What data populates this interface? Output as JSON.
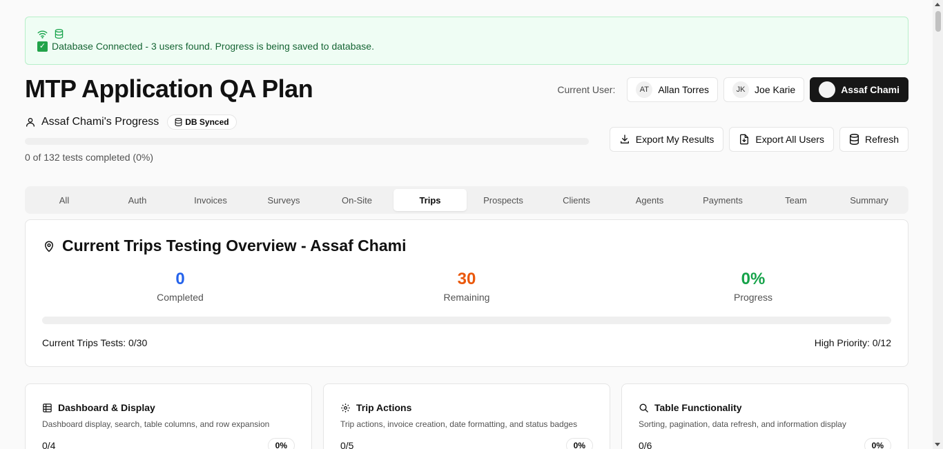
{
  "banner": {
    "message": "Database Connected - 3 users found. Progress is being saved to database.",
    "icons": [
      "wifi-icon",
      "database-icon",
      "check-icon"
    ]
  },
  "header": {
    "title": "MTP Application QA Plan",
    "current_user_label": "Current User:",
    "users": [
      {
        "initials": "AT",
        "name": "Allan Torres",
        "active": false
      },
      {
        "initials": "JK",
        "name": "Joe Karie",
        "active": false
      },
      {
        "initials": "",
        "name": "Assaf Chami",
        "active": true
      }
    ]
  },
  "progress": {
    "name": "Assaf Chami's Progress",
    "badge": "DB Synced",
    "summary": "0 of 132 tests completed (0%)",
    "fraction": 0
  },
  "actions": {
    "export_mine": "Export My Results",
    "export_all": "Export All Users",
    "refresh": "Refresh"
  },
  "tabs": [
    "All",
    "Auth",
    "Invoices",
    "Surveys",
    "On-Site",
    "Trips",
    "Prospects",
    "Clients",
    "Agents",
    "Payments",
    "Team",
    "Summary"
  ],
  "active_tab": "Trips",
  "overview": {
    "title": "Current Trips Testing Overview - Assaf Chami",
    "completed": {
      "value": "0",
      "label": "Completed",
      "color": "#2563eb"
    },
    "remaining": {
      "value": "30",
      "label": "Remaining",
      "color": "#ea580c"
    },
    "progress": {
      "value": "0%",
      "label": "Progress",
      "color": "#16a34a"
    },
    "bar_fraction": 0,
    "tests": "Current Trips Tests: 0/30",
    "high_priority": "High Priority: 0/12"
  },
  "cards": [
    {
      "title": "Dashboard & Display",
      "desc": "Dashboard display, search, table columns, and row expansion",
      "count": "0/4",
      "pct": "0%",
      "icon": "table-icon"
    },
    {
      "title": "Trip Actions",
      "desc": "Trip actions, invoice creation, date formatting, and status badges",
      "count": "0/5",
      "pct": "0%",
      "icon": "gear-icon"
    },
    {
      "title": "Table Functionality",
      "desc": "Sorting, pagination, data refresh, and information display",
      "count": "0/6",
      "pct": "0%",
      "icon": "search-icon"
    }
  ]
}
